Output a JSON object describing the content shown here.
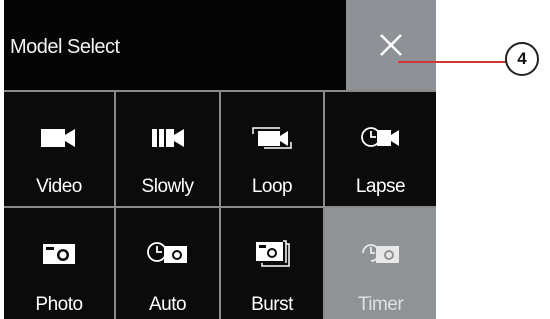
{
  "header": {
    "title": "Model Select"
  },
  "colors": {
    "background": "#0b0b0b",
    "selected": "#8f9396",
    "callout_line": "#d0393a"
  },
  "modes": [
    {
      "label": "Video",
      "icon": "video-camera-icon"
    },
    {
      "label": "Slowly",
      "icon": "slow-motion-icon"
    },
    {
      "label": "Loop",
      "icon": "loop-record-icon"
    },
    {
      "label": "Lapse",
      "icon": "time-lapse-icon"
    },
    {
      "label": "Photo",
      "icon": "photo-camera-icon"
    },
    {
      "label": "Auto",
      "icon": "auto-photo-icon"
    },
    {
      "label": "Burst",
      "icon": "burst-photo-icon"
    },
    {
      "label": "Timer",
      "icon": "self-timer-icon",
      "selected": true
    }
  ],
  "callout": {
    "number": "4"
  }
}
